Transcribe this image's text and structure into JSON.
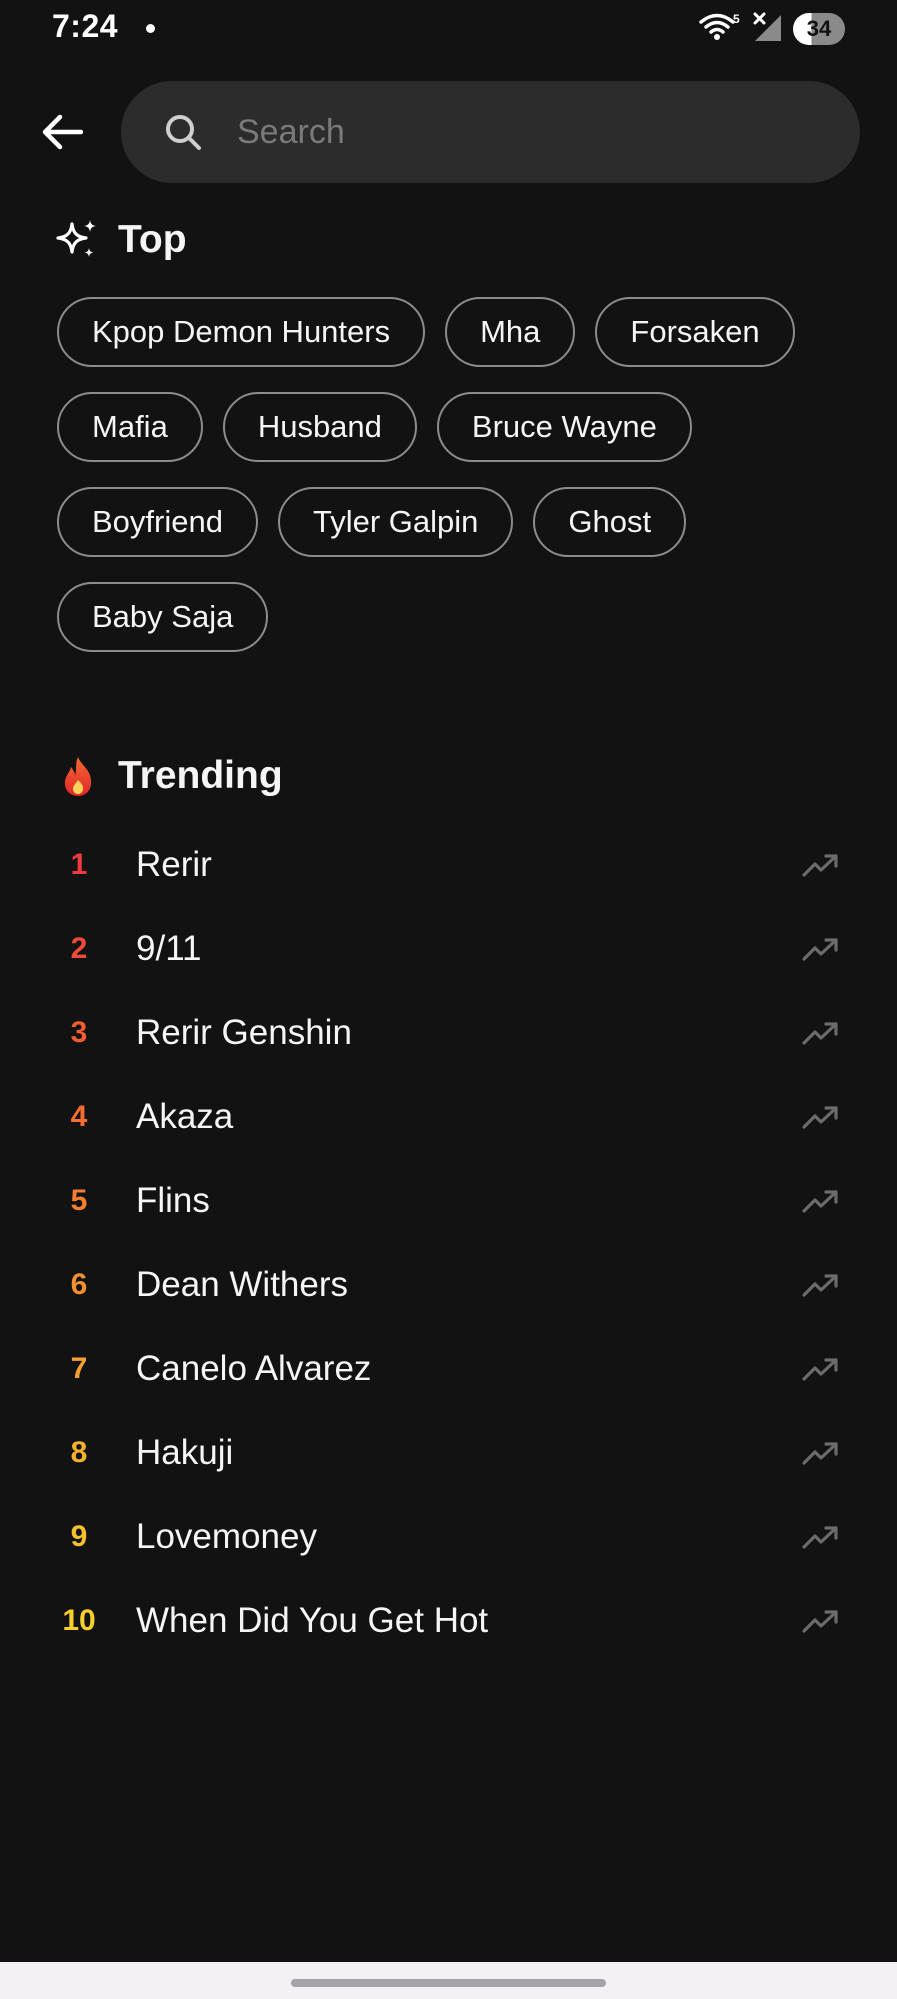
{
  "status_bar": {
    "time": "7:24",
    "battery": "34",
    "wifi_label": "5"
  },
  "search": {
    "placeholder": "Search",
    "value": ""
  },
  "top": {
    "title": "Top",
    "chips": [
      "Kpop Demon Hunters",
      "Mha",
      "Forsaken",
      "Mafia",
      "Husband",
      "Bruce Wayne",
      "Boyfriend",
      "Tyler Galpin",
      "Ghost",
      "Baby Saja"
    ]
  },
  "trending": {
    "title": "Trending",
    "items": [
      {
        "rank": "1",
        "label": "Rerir",
        "color": "#ef3b3b"
      },
      {
        "rank": "2",
        "label": "9/11",
        "color": "#f04b36"
      },
      {
        "rank": "3",
        "label": "Rerir Genshin",
        "color": "#f25c33"
      },
      {
        "rank": "4",
        "label": "Akaza",
        "color": "#f46d32"
      },
      {
        "rank": "5",
        "label": "Flins",
        "color": "#f47f30"
      },
      {
        "rank": "6",
        "label": "Dean Withers",
        "color": "#f5902f"
      },
      {
        "rank": "7",
        "label": "Canelo Alvarez",
        "color": "#f5a12e"
      },
      {
        "rank": "8",
        "label": "Hakuji",
        "color": "#f6b22d"
      },
      {
        "rank": "9",
        "label": "Lovemoney",
        "color": "#f6c12c"
      },
      {
        "rank": "10",
        "label": "When Did You Get Hot",
        "color": "#f7cf2b"
      }
    ]
  },
  "icons": {
    "back": "back-arrow-icon",
    "search": "search-icon",
    "top": "sparkle-icon",
    "trending": "fire-icon",
    "row": "trending-up-icon"
  },
  "colors": {
    "background": "#121212",
    "search_bg": "#2c2c2c",
    "chip_border": "#8c8c8c",
    "arrow": "#6b6b6b"
  }
}
